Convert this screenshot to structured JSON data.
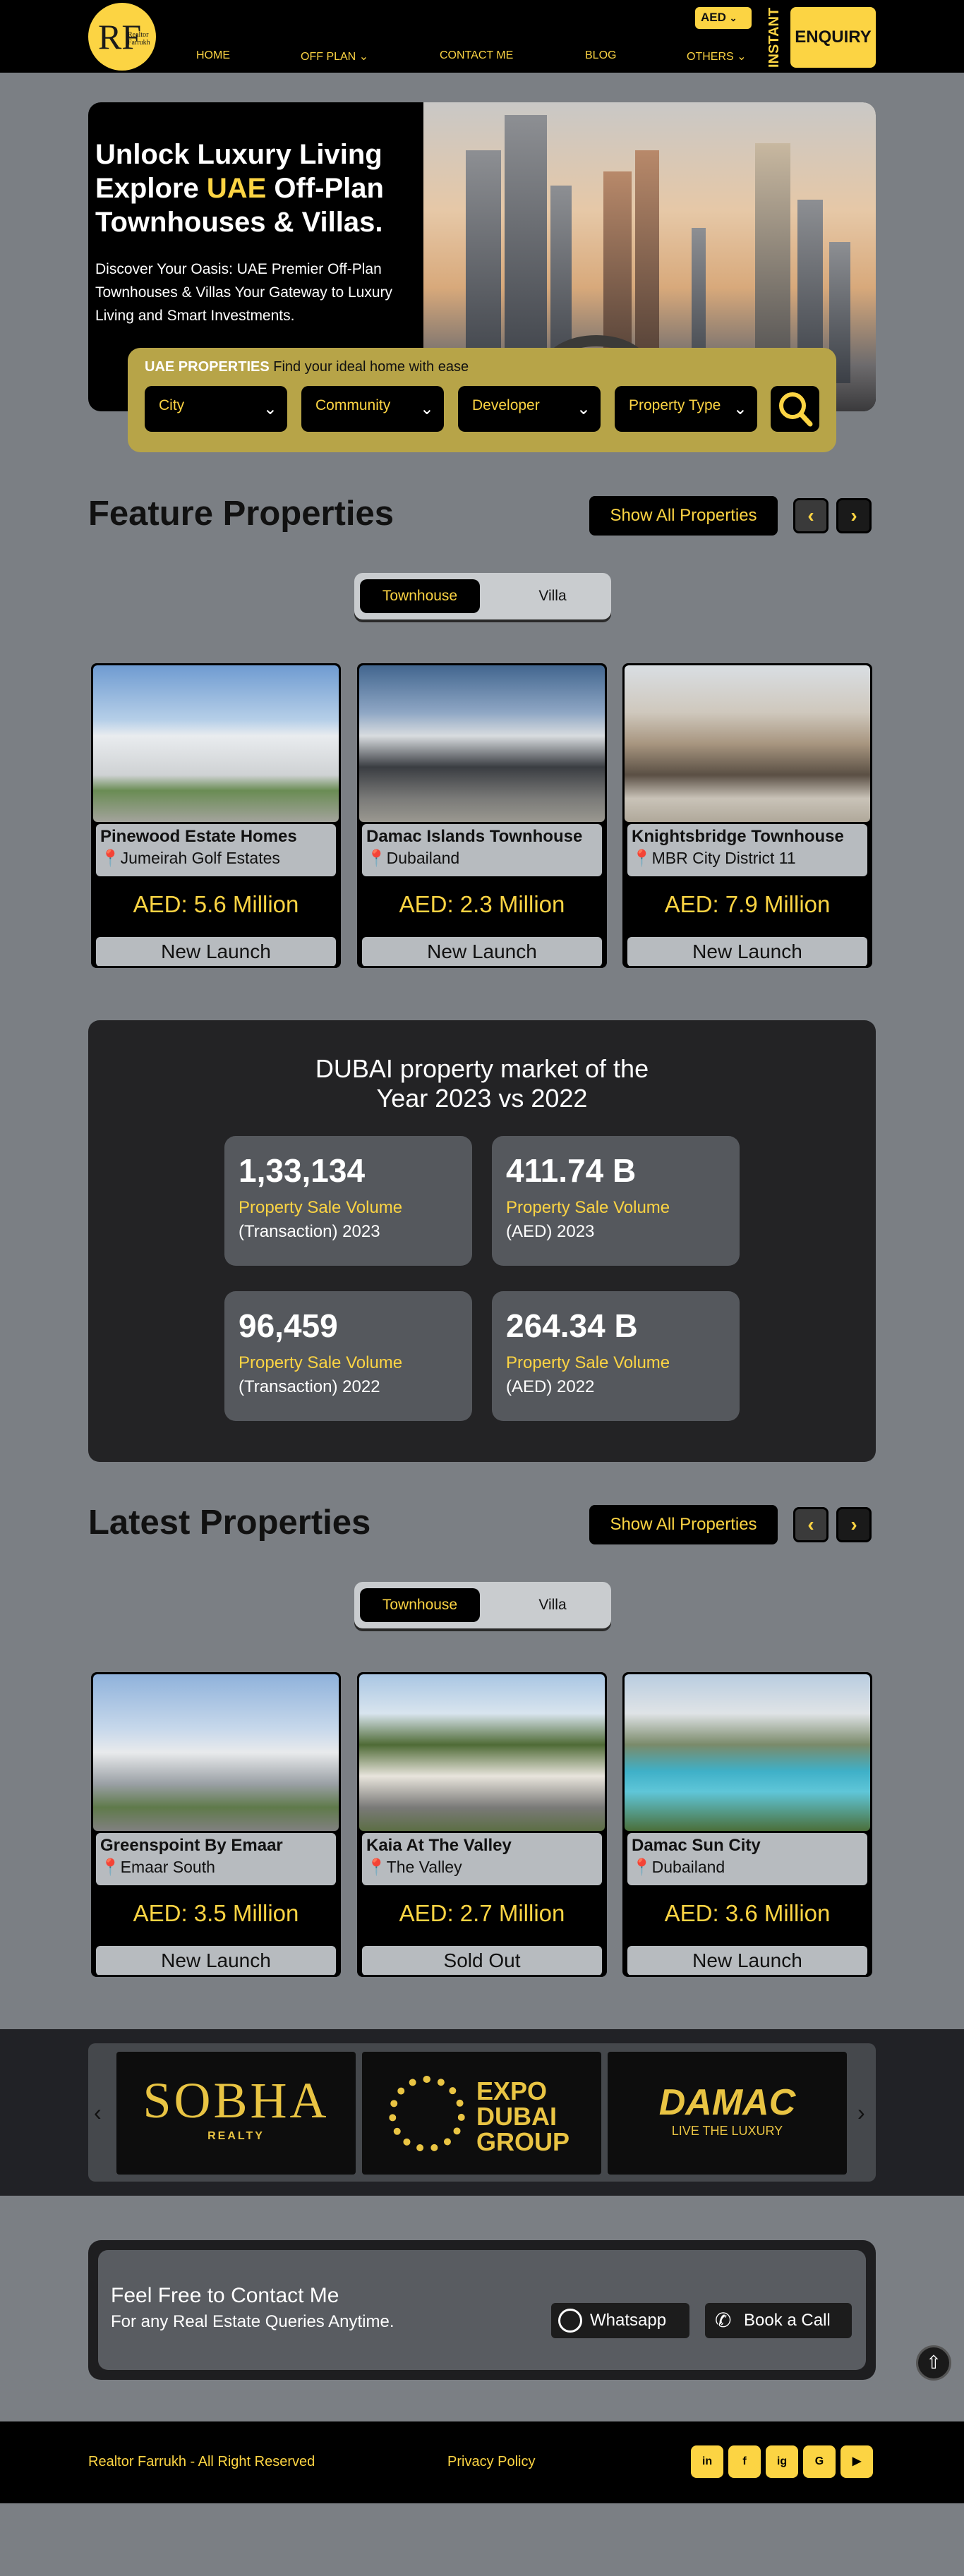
{
  "header": {
    "logo_text": "RF",
    "logo_sub": "Realtor Farrukh",
    "nav": [
      "HOME",
      "OFF PLAN",
      "CONTACT ME",
      "BLOG",
      "OTHERS"
    ],
    "currency": "AED",
    "instant": "INSTANT",
    "enquiry": "ENQUIRY"
  },
  "hero": {
    "title_line1": "Unlock Luxury Living",
    "title_line2a": "Explore ",
    "title_line2b": "UAE",
    "title_line2c": " Off-Plan",
    "title_line3": "Townhouses & Villas.",
    "desc": "Discover Your Oasis: UAE Premier Off-Plan Townhouses & Villas Your Gateway to Luxury Living and Smart Investments."
  },
  "search": {
    "label_bold": "UAE PROPERTIES",
    "label_rest": " Find your ideal home with ease",
    "fields": [
      "City",
      "Community",
      "Developer",
      "Property Type"
    ]
  },
  "featured": {
    "title": "Feature Properties",
    "show_all": "Show All Properties",
    "tabs": [
      "Townhouse",
      "Villa"
    ],
    "cards": [
      {
        "name": "Pinewood Estate Homes",
        "location": "Jumeirah Golf Estates",
        "price": "AED: 5.6 Million",
        "status": "New Launch"
      },
      {
        "name": "Damac Islands Townhouse",
        "location": "Dubailand",
        "price": "AED: 2.3 Million",
        "status": "New Launch"
      },
      {
        "name": "Knightsbridge Townhouse",
        "location": "MBR City District 11",
        "price": "AED: 7.9 Million",
        "status": "New Launch"
      }
    ]
  },
  "stats": {
    "title_line1": "DUBAI property market of the",
    "title_line2": "Year 2023 vs 2022",
    "items": [
      {
        "number": "1,33,134",
        "label": "Property Sale Volume",
        "sub": "(Transaction) 2023"
      },
      {
        "number": "411.74 B",
        "label": "Property Sale Volume",
        "sub": "(AED) 2023"
      },
      {
        "number": "96,459",
        "label": "Property Sale Volume",
        "sub": "(Transaction) 2022"
      },
      {
        "number": "264.34 B",
        "label": "Property Sale Volume",
        "sub": "(AED) 2022"
      }
    ]
  },
  "latest": {
    "title": "Latest Properties",
    "show_all": "Show All Properties",
    "tabs": [
      "Townhouse",
      "Villa"
    ],
    "cards": [
      {
        "name": "Greenspoint By Emaar",
        "location": "Emaar South",
        "price": "AED: 3.5 Million",
        "status": "New Launch"
      },
      {
        "name": "Kaia At The Valley",
        "location": "The Valley",
        "price": "AED: 2.7 Million",
        "status": "Sold Out"
      },
      {
        "name": "Damac Sun City",
        "location": "Dubailand",
        "price": "AED: 3.6 Million",
        "status": "New Launch"
      }
    ]
  },
  "partners": {
    "sobha": "SOBHA",
    "sobha_sub": "REALTY",
    "expo1": "EXPO",
    "expo2": "DUBAI",
    "expo3": "GROUP",
    "damac": "DAMAC",
    "damac_sub": "LIVE THE LUXURY"
  },
  "contact": {
    "title": "Feel Free to Contact Me",
    "sub": "For any Real Estate Queries Anytime.",
    "whatsapp": "Whatsapp",
    "call": "Book a Call"
  },
  "footer": {
    "copyright": "Realtor Farrukh - All Right Reserved",
    "privacy": "Privacy Policy",
    "social": [
      "in",
      "f",
      "ig",
      "G",
      "▶"
    ]
  },
  "colors": {
    "accent": "#fcd443",
    "background": "#7b7f84",
    "dark": "#000000"
  }
}
